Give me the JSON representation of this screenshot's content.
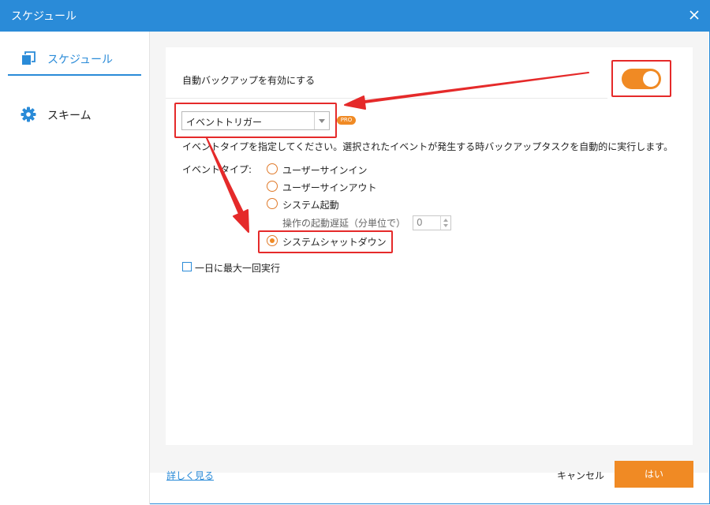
{
  "window": {
    "title": "スケジュール",
    "colors": {
      "titlebar": "#2a8bd8",
      "accent": "#f08a24",
      "highlight": "#e52a2a"
    }
  },
  "sidebar": {
    "items": [
      {
        "label": "スケジュール",
        "icon": "copy-icon",
        "active": true
      },
      {
        "label": "スキーム",
        "icon": "gear-icon",
        "active": false
      }
    ]
  },
  "main": {
    "auto_backup_label": "自動バックアップを有効にする",
    "auto_backup_on": true,
    "trigger_select": {
      "value": "イベントトリガー"
    },
    "pro_badge": "PRO",
    "description": "イベントタイプを指定してください。選択されたイベントが発生する時バックアップタスクを自動的に実行します。",
    "event_type_label": "イベントタイプ:",
    "event_types": [
      {
        "label": "ユーザーサインイン",
        "checked": false
      },
      {
        "label": "ユーザーサインアウト",
        "checked": false
      },
      {
        "label": "システム起動",
        "checked": false
      },
      {
        "label": "システムシャットダウン",
        "checked": true
      }
    ],
    "startup_delay_label": "操作の起動遅延（分単位で）",
    "startup_delay_value": "0",
    "once_per_day_label": "一日に最大一回実行",
    "once_per_day_checked": false
  },
  "footer": {
    "more_link": "詳しく見る",
    "cancel_label": "キャンセル",
    "ok_label": "はい"
  }
}
